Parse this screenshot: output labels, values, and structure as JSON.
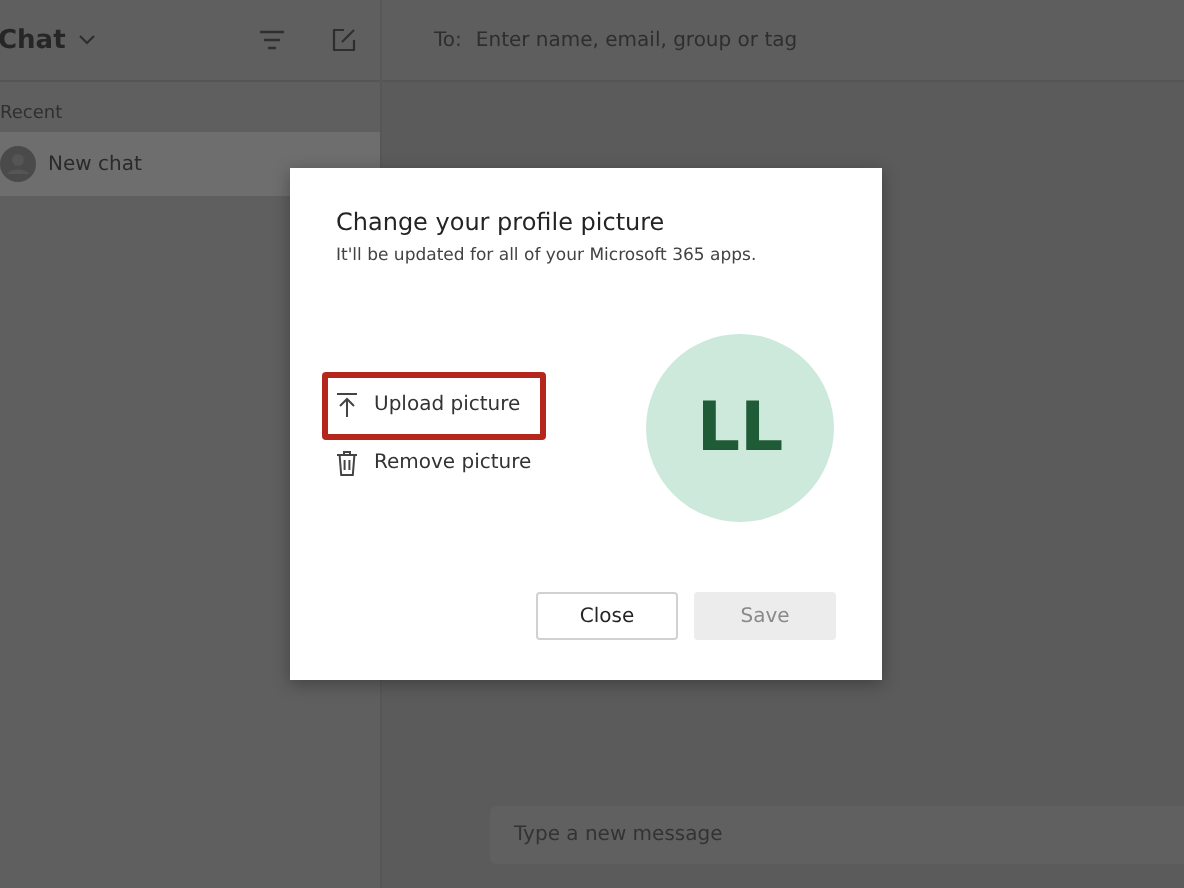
{
  "sidebar": {
    "title": "Chat",
    "section_label": "Recent",
    "items": [
      {
        "label": "New chat",
        "selected": true
      }
    ]
  },
  "compose": {
    "to_label": "To:",
    "to_placeholder": "Enter name, email, group or tag",
    "message_placeholder": "Type a new message"
  },
  "dialog": {
    "title": "Change your profile picture",
    "subtitle": "It'll be updated for all of your Microsoft 365 apps.",
    "actions": [
      {
        "kind": "upload",
        "label": "Upload picture",
        "highlighted": true
      },
      {
        "kind": "remove",
        "label": "Remove picture",
        "highlighted": false
      }
    ],
    "avatar_initials": "LL",
    "buttons": [
      {
        "label": "Close",
        "disabled": false
      },
      {
        "label": "Save",
        "disabled": true
      }
    ]
  }
}
